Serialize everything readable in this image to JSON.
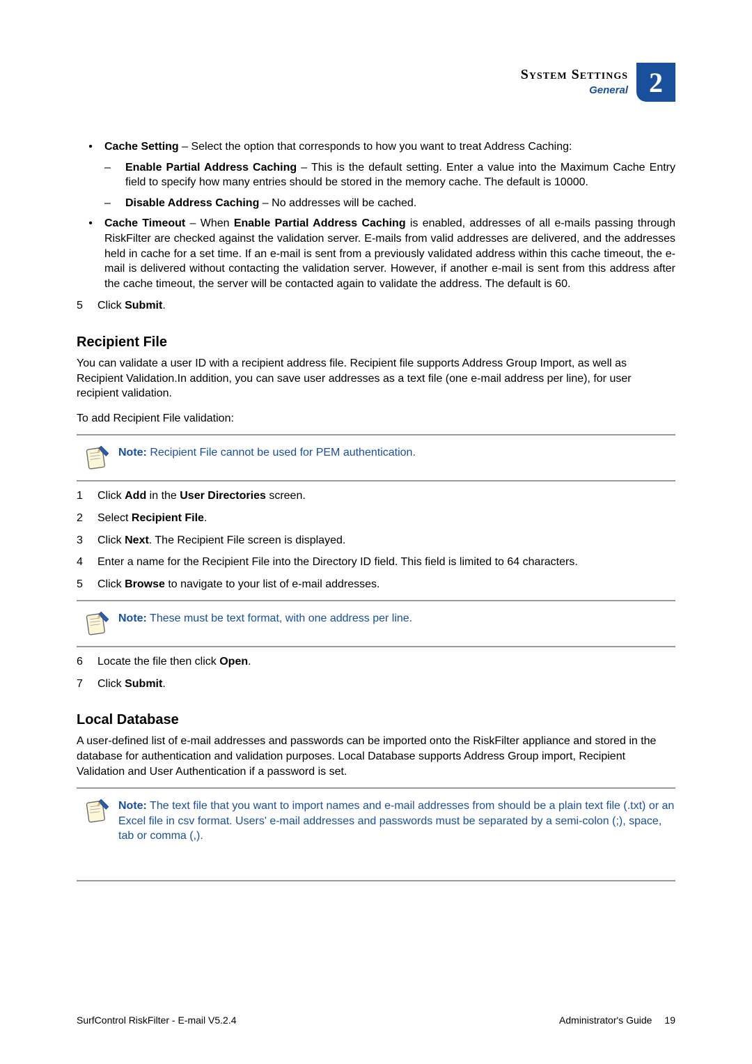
{
  "header": {
    "title": "System Settings",
    "sub": "General",
    "chapter": "2"
  },
  "cache_setting": {
    "label": "Cache Setting",
    "desc": " – Select the option that corresponds to how you want to treat Address Caching:",
    "enable": {
      "label": "Enable Partial Address Caching",
      "desc": " – This is the default setting. Enter a value into the Maximum Cache Entry field to specify how many entries should be stored in the memory cache. The default is 10000."
    },
    "disable": {
      "label": "Disable Address Caching",
      "desc": " – No addresses will be cached."
    }
  },
  "cache_timeout": {
    "label": "Cache Timeout",
    "pre": " – When ",
    "mid_label": "Enable Partial Address Caching",
    "post": " is enabled, addresses of all e-mails passing through RiskFilter are checked against the validation server. E-mails from valid addresses are delivered, and the addresses held in cache for a set time. If an e-mail is sent from a previously validated address within this cache timeout, the e-mail is delivered without contacting the validation server. However, if another e-mail is sent from this address after the cache timeout, the server will be contacted again to validate the address. The default is 60."
  },
  "step5a": {
    "num": "5",
    "pre": "Click ",
    "b": "Submit",
    "post": "."
  },
  "recipient": {
    "head": "Recipient File",
    "para": "You can validate a user ID with a recipient address file. Recipient file supports Address Group Import, as well as Recipient Validation.In addition, you can save user addresses as a text file (one e-mail address per line), for user recipient validation.",
    "intro": "To add Recipient File validation:",
    "note_lbl": "Note:",
    "note": "  Recipient File cannot be used for PEM authentication.",
    "s1": {
      "num": "1",
      "pre": "Click ",
      "b1": "Add",
      "mid": " in the ",
      "b2": "User Directories",
      "post": " screen."
    },
    "s2": {
      "num": "2",
      "pre": "Select ",
      "b": "Recipient File",
      "post": "."
    },
    "s3": {
      "num": "3",
      "pre": "Click ",
      "b": "Next",
      "post": ". The Recipient File screen is displayed."
    },
    "s4": {
      "num": "4",
      "text": "Enter a name for the Recipient File into the Directory ID field. This field is limited to 64 characters."
    },
    "s5": {
      "num": "5",
      "pre": "Click ",
      "b": "Browse",
      "post": "  to navigate to your list of e-mail addresses."
    },
    "note2_lbl": "Note:",
    "note2": "  These must be text format, with one address per line.",
    "s6": {
      "num": "6",
      "pre": "Locate the file then click ",
      "b": "Open",
      "post": "."
    },
    "s7": {
      "num": "7",
      "pre": "Click ",
      "b": "Submit",
      "post": "."
    }
  },
  "localdb": {
    "head": "Local Database",
    "para": "A user-defined list of e-mail addresses and passwords can be imported onto the RiskFilter appliance and stored in the database for authentication and validation purposes. Local Database supports Address Group import, Recipient Validation and User Authentication if a password is set.",
    "note_lbl": "Note:",
    "note": "  The text file that you want to import names and e-mail addresses from should be a plain text file (.txt) or an Excel file in csv format. Users' e-mail addresses and passwords must be separated by a semi-colon (;), space, tab or comma (,)."
  },
  "footer": {
    "left": "SurfControl RiskFilter - E-mail V5.2.4",
    "right": "Administrator's Guide",
    "page": "19"
  }
}
